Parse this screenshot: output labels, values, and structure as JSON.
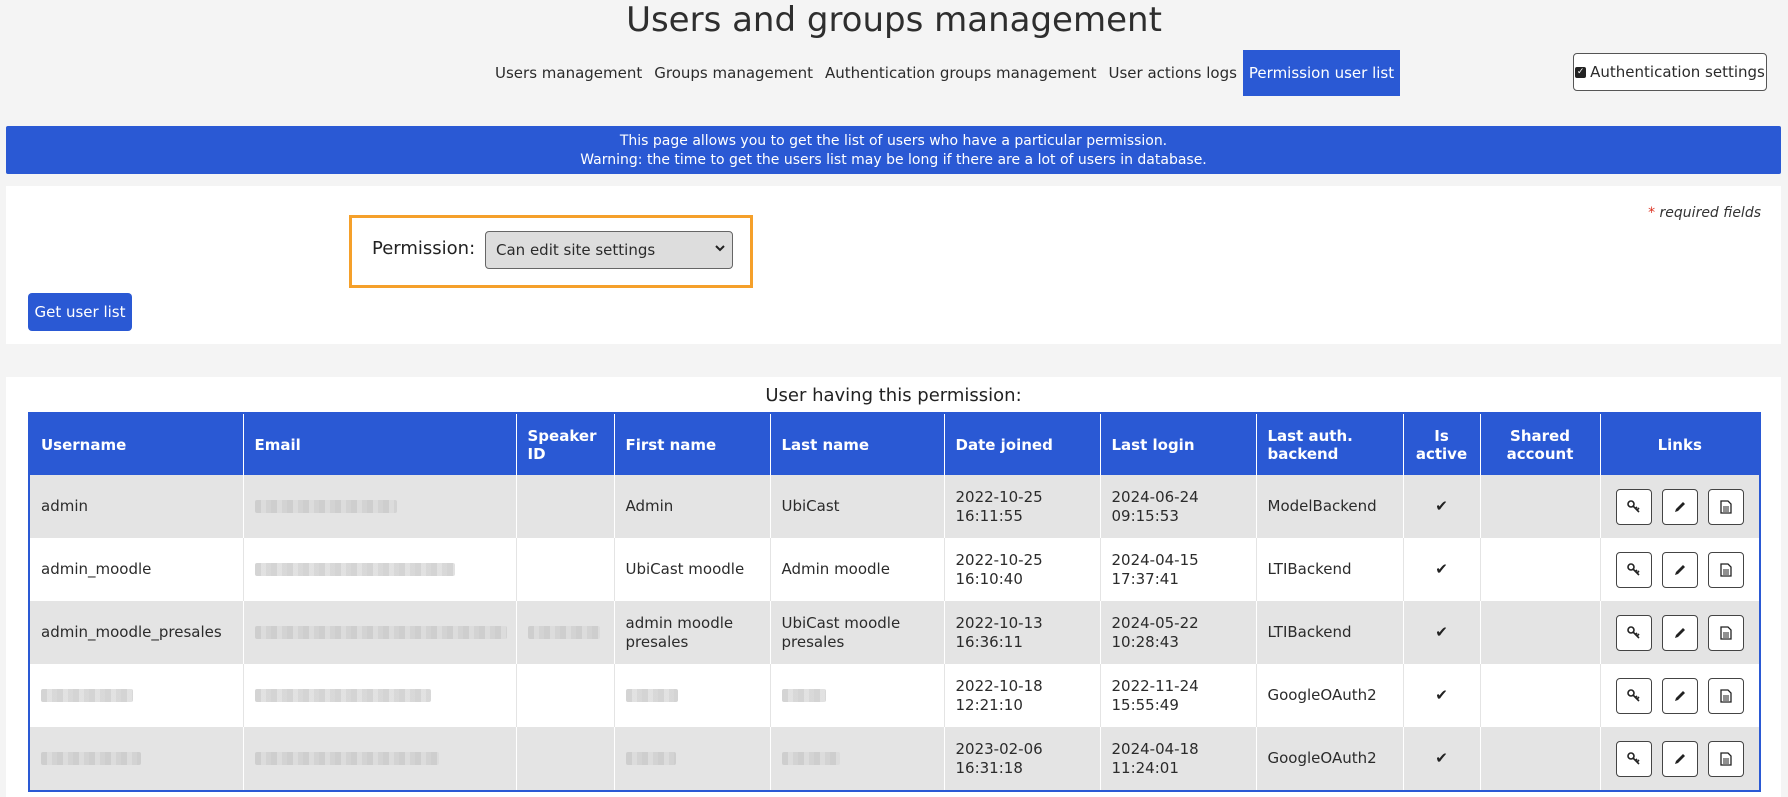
{
  "page": {
    "title": "Users and groups management"
  },
  "tabs": [
    {
      "label": "Users management",
      "active": false
    },
    {
      "label": "Groups management",
      "active": false
    },
    {
      "label": "Authentication groups management",
      "active": false
    },
    {
      "label": "User actions logs",
      "active": false
    },
    {
      "label": "Permission user list",
      "active": true
    }
  ],
  "auth_settings": {
    "label": "Authentication settings",
    "icon": "checkbox-icon"
  },
  "info": {
    "line1": "This page allows you to get the list of users who have a particular permission.",
    "line2": "Warning: the time to get the users list may be long if there are a lot of users in database."
  },
  "form": {
    "required_star": "*",
    "required_text": "required fields",
    "permission_label": "Permission:",
    "permission_value": "Can edit site settings",
    "submit_label": "Get user list"
  },
  "table": {
    "caption": "User having this permission:",
    "columns": [
      "Username",
      "Email",
      "Speaker ID",
      "First name",
      "Last name",
      "Date joined",
      "Last login",
      "Last auth. backend",
      "Is active",
      "Shared account",
      "Links"
    ],
    "rows": [
      {
        "username": "admin",
        "email": "",
        "speaker_id": "",
        "first_name": "Admin",
        "last_name": "UbiCast",
        "date_joined": "2022-10-25 16:11:55",
        "last_login": "2024-06-24 09:15:53",
        "backend": "ModelBackend",
        "is_active": "✔",
        "shared": ""
      },
      {
        "username": "admin_moodle",
        "email": "",
        "speaker_id": "",
        "first_name": "UbiCast moodle",
        "last_name": "Admin moodle",
        "date_joined": "2022-10-25 16:10:40",
        "last_login": "2024-04-15 17:37:41",
        "backend": "LTIBackend",
        "is_active": "✔",
        "shared": ""
      },
      {
        "username": "admin_moodle_presales",
        "email": "",
        "speaker_id": "",
        "first_name": "admin moodle presales",
        "last_name": "UbiCast moodle presales",
        "date_joined": "2022-10-13 16:36:11",
        "last_login": "2024-05-22 10:28:43",
        "backend": "LTIBackend",
        "is_active": "✔",
        "shared": ""
      },
      {
        "username": "",
        "email": "",
        "speaker_id": "",
        "first_name": "",
        "last_name": "",
        "date_joined": "2022-10-18 12:21:10",
        "last_login": "2022-11-24 15:55:49",
        "backend": "GoogleOAuth2",
        "is_active": "✔",
        "shared": ""
      },
      {
        "username": "",
        "email": "",
        "speaker_id": "",
        "first_name": "",
        "last_name": "",
        "date_joined": "2023-02-06 16:31:18",
        "last_login": "2024-04-18 11:24:01",
        "backend": "GoogleOAuth2",
        "is_active": "✔",
        "shared": ""
      }
    ],
    "link_icons": [
      "key-icon",
      "pencil-icon",
      "document-icon"
    ]
  }
}
